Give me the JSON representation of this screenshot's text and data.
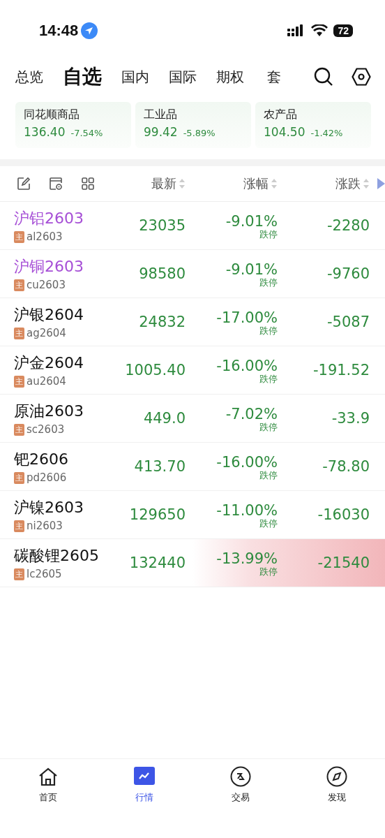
{
  "status_bar": {
    "time": "14:48",
    "battery": "72"
  },
  "tabs": [
    {
      "label": "总览",
      "selected": false
    },
    {
      "label": "自选",
      "selected": true
    },
    {
      "label": "国内",
      "selected": false
    },
    {
      "label": "国际",
      "selected": false
    },
    {
      "label": "期权",
      "selected": false
    },
    {
      "label": "套",
      "selected": false
    }
  ],
  "index_cards": [
    {
      "name": "同花顺商品",
      "value": "136.40",
      "change": "-7.54%"
    },
    {
      "name": "工业品",
      "value": "99.42",
      "change": "-5.89%"
    },
    {
      "name": "农产品",
      "value": "104.50",
      "change": "-1.42%"
    }
  ],
  "table": {
    "columns": [
      "最新",
      "涨幅",
      "涨跌"
    ],
    "rows": [
      {
        "name": "沪铝2603",
        "code": "al2603",
        "badge": "主",
        "latest": "23035",
        "pct": "-9.01%",
        "limit": "跌停",
        "change": "-2280",
        "color": "#a64fd6",
        "highlighted": false
      },
      {
        "name": "沪铜2603",
        "code": "cu2603",
        "badge": "主",
        "latest": "98580",
        "pct": "-9.01%",
        "limit": "跌停",
        "change": "-9760",
        "color": "#a64fd6",
        "highlighted": false
      },
      {
        "name": "沪银2604",
        "code": "ag2604",
        "badge": "主",
        "latest": "24832",
        "pct": "-17.00%",
        "limit": "跌停",
        "change": "-5087",
        "color": "#111111",
        "highlighted": false
      },
      {
        "name": "沪金2604",
        "code": "au2604",
        "badge": "主",
        "latest": "1005.40",
        "pct": "-16.00%",
        "limit": "跌停",
        "change": "-191.52",
        "color": "#111111",
        "highlighted": false
      },
      {
        "name": "原油2603",
        "code": "sc2603",
        "badge": "主",
        "latest": "449.0",
        "pct": "-7.02%",
        "limit": "跌停",
        "change": "-33.9",
        "color": "#111111",
        "highlighted": false
      },
      {
        "name": "钯2606",
        "code": "pd2606",
        "badge": "主",
        "latest": "413.70",
        "pct": "-16.00%",
        "limit": "跌停",
        "change": "-78.80",
        "color": "#111111",
        "highlighted": false
      },
      {
        "name": "沪镍2603",
        "code": "ni2603",
        "badge": "主",
        "latest": "129650",
        "pct": "-11.00%",
        "limit": "跌停",
        "change": "-16030",
        "color": "#111111",
        "highlighted": false
      },
      {
        "name": "碳酸锂2605",
        "code": "lc2605",
        "badge": "主",
        "latest": "132440",
        "pct": "-13.99%",
        "limit": "跌停",
        "change": "-21540",
        "color": "#111111",
        "highlighted": true
      }
    ]
  },
  "bottom_nav": [
    {
      "label": "首页",
      "kind": "home",
      "selected": false
    },
    {
      "label": "行情",
      "kind": "chart",
      "selected": true
    },
    {
      "label": "交易",
      "kind": "trade",
      "selected": false
    },
    {
      "label": "发现",
      "kind": "compass",
      "selected": false
    }
  ]
}
